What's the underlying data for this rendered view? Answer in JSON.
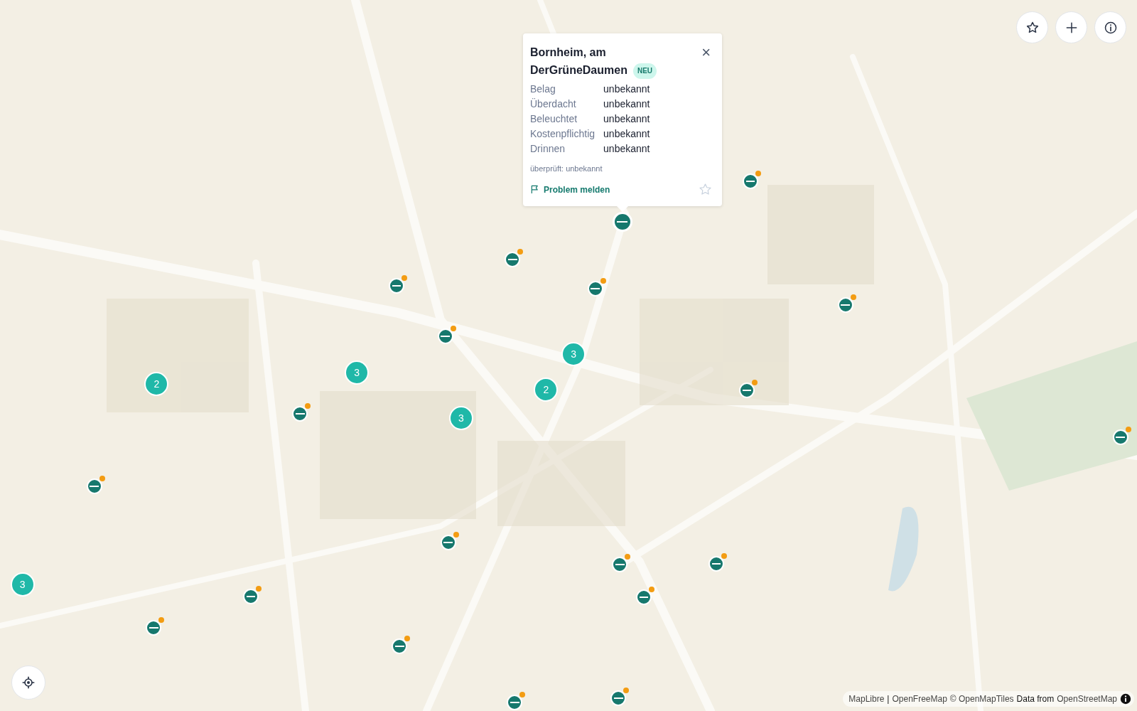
{
  "popup": {
    "title": "Bornheim, am DerGrüneDaumen",
    "badge": "NEU",
    "close": "×",
    "properties": [
      {
        "label": "Belag",
        "value": "unbekannt"
      },
      {
        "label": "Überdacht",
        "value": "unbekannt"
      },
      {
        "label": "Beleuchtet",
        "value": "unbekannt"
      },
      {
        "label": "Kostenpflichtig",
        "value": "unbekannt"
      },
      {
        "label": "Drinnen",
        "value": "unbekannt"
      }
    ],
    "checked": "überprüft: unbekannt",
    "report_link": "Problem melden",
    "favorite": false
  },
  "markers": [
    {
      "kind": "station",
      "flagged": false,
      "selected": true
    },
    {
      "kind": "station",
      "flagged": true,
      "selected": false
    },
    {
      "kind": "station",
      "flagged": true,
      "selected": false
    },
    {
      "kind": "station",
      "flagged": true,
      "selected": false
    },
    {
      "kind": "station",
      "flagged": true,
      "selected": false
    },
    {
      "kind": "station",
      "flagged": true,
      "selected": false
    },
    {
      "kind": "station",
      "flagged": true,
      "selected": false
    },
    {
      "kind": "station",
      "flagged": true,
      "selected": false
    },
    {
      "kind": "station",
      "flagged": true,
      "selected": false
    },
    {
      "kind": "station",
      "flagged": true,
      "selected": false
    },
    {
      "kind": "station",
      "flagged": true,
      "selected": false
    },
    {
      "kind": "station",
      "flagged": true,
      "selected": false
    },
    {
      "kind": "station",
      "flagged": true,
      "selected": false
    },
    {
      "kind": "station",
      "flagged": true,
      "selected": false
    },
    {
      "kind": "station",
      "flagged": true,
      "selected": false
    },
    {
      "kind": "station",
      "flagged": true,
      "selected": false
    },
    {
      "kind": "station",
      "flagged": true,
      "selected": false
    },
    {
      "kind": "station",
      "flagged": true,
      "selected": false
    },
    {
      "kind": "station",
      "flagged": true,
      "selected": false
    },
    {
      "kind": "station",
      "flagged": true,
      "selected": false
    },
    {
      "kind": "cluster",
      "count": "2"
    },
    {
      "kind": "cluster",
      "count": "3"
    },
    {
      "kind": "cluster",
      "count": "3"
    },
    {
      "kind": "cluster",
      "count": "2"
    },
    {
      "kind": "cluster",
      "count": "3"
    },
    {
      "kind": "cluster",
      "count": "3"
    }
  ],
  "attribution": [
    {
      "kind": "link",
      "text": "MapLibre"
    },
    {
      "kind": "text",
      "text": "|"
    },
    {
      "kind": "link",
      "text": "OpenFreeMap"
    },
    {
      "kind": "link",
      "text": "© OpenMapTiles"
    },
    {
      "kind": "text",
      "text": "Data from"
    },
    {
      "kind": "link",
      "text": "OpenStreetMap"
    }
  ]
}
